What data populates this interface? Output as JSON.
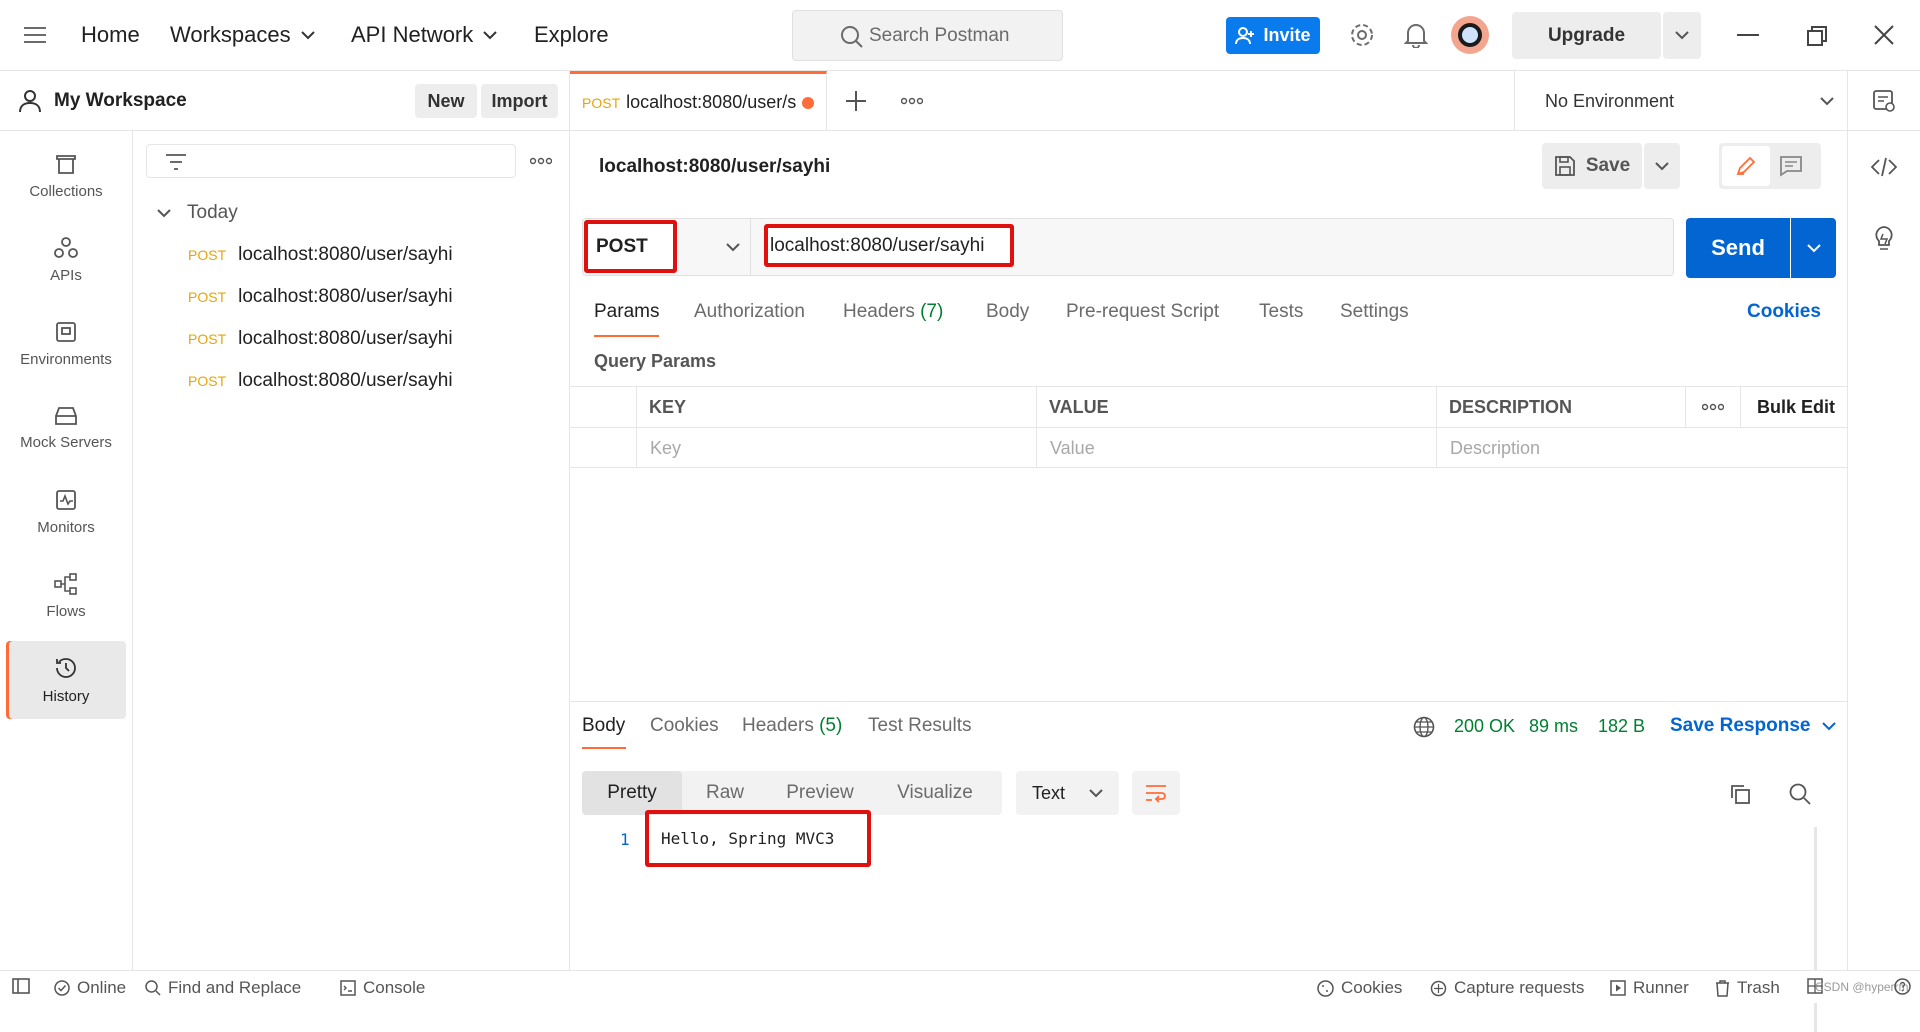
{
  "topbar": {
    "nav": [
      "Home",
      "Workspaces",
      "API Network",
      "Explore"
    ],
    "search_placeholder": "Search Postman",
    "invite_label": "Invite",
    "upgrade_label": "Upgrade"
  },
  "workspace": {
    "title": "My Workspace",
    "new_label": "New",
    "import_label": "Import"
  },
  "rail": [
    "Collections",
    "APIs",
    "Environments",
    "Mock Servers",
    "Monitors",
    "Flows",
    "History"
  ],
  "history": {
    "group": "Today",
    "items": [
      {
        "method": "POST",
        "url": "localhost:8080/user/sayhi"
      },
      {
        "method": "POST",
        "url": "localhost:8080/user/sayhi"
      },
      {
        "method": "POST",
        "url": "localhost:8080/user/sayhi"
      },
      {
        "method": "POST",
        "url": "localhost:8080/user/sayhi"
      }
    ]
  },
  "tabbar": {
    "tab_method": "POST",
    "tab_title": "localhost:8080/user/s",
    "environment": "No Environment"
  },
  "request": {
    "title": "localhost:8080/user/sayhi",
    "save_label": "Save",
    "method": "POST",
    "url": "localhost:8080/user/sayhi",
    "send_label": "Send",
    "tabs": [
      "Params",
      "Authorization",
      "Headers",
      "(7)",
      "Body",
      "Pre-request Script",
      "Tests",
      "Settings"
    ],
    "cookies_label": "Cookies",
    "query_title": "Query Params",
    "columns": [
      "KEY",
      "VALUE",
      "DESCRIPTION"
    ],
    "bulk_edit": "Bulk Edit",
    "placeholders": [
      "Key",
      "Value",
      "Description"
    ]
  },
  "response": {
    "tabs": [
      "Body",
      "Cookies",
      "Headers",
      "(5)",
      "Test Results"
    ],
    "status": "200 OK",
    "time": "89 ms",
    "size": "182 B",
    "save_response": "Save Response",
    "views": [
      "Pretty",
      "Raw",
      "Preview",
      "Visualize"
    ],
    "format": "Text",
    "line_no": "1",
    "body": "Hello, Spring MVC3"
  },
  "statusbar": {
    "left": [
      "Online",
      "Find and Replace",
      "Console"
    ],
    "right": [
      "Cookies",
      "Capture requests",
      "Runner",
      "Trash"
    ],
    "watermark": "CSDN @hyperrm"
  },
  "colors": {
    "accent": "#ff6c37",
    "primary": "#0265d2",
    "invite": "#097bed",
    "success": "#007f31",
    "highlight": "#e0100e"
  }
}
